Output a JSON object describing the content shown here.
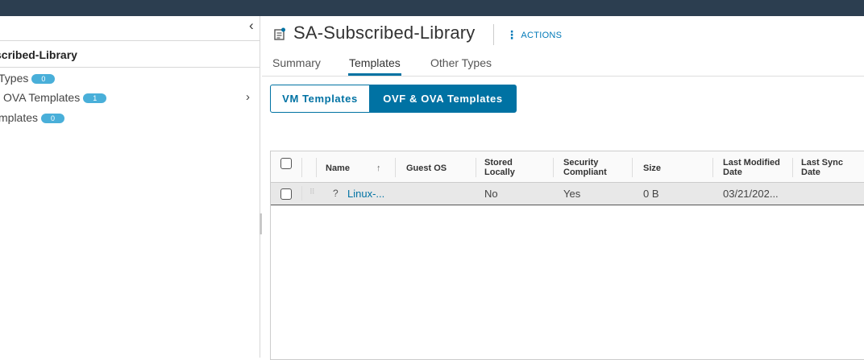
{
  "left_panel": {
    "library_name": "scribed-Library",
    "items": [
      {
        "label": "Types",
        "count": "0"
      },
      {
        "label": "OVA Templates",
        "count": "1"
      },
      {
        "label": "mplates",
        "count": "0"
      }
    ]
  },
  "header": {
    "title": "SA-Subscribed-Library",
    "actions_label": "ACTIONS"
  },
  "tabs": [
    {
      "label": "Summary",
      "active": false
    },
    {
      "label": "Templates",
      "active": true
    },
    {
      "label": "Other Types",
      "active": false
    }
  ],
  "segments": [
    {
      "label": "VM Templates",
      "active": false
    },
    {
      "label": "OVF & OVA Templates",
      "active": true
    }
  ],
  "table": {
    "columns": [
      {
        "line1": "Name",
        "line2": "",
        "sort": "↑"
      },
      {
        "line1": "Guest OS",
        "line2": ""
      },
      {
        "line1": "Stored",
        "line2": "Locally"
      },
      {
        "line1": "Security",
        "line2": "Compliant"
      },
      {
        "line1": "Size",
        "line2": ""
      },
      {
        "line1": "Last Modified",
        "line2": "Date"
      },
      {
        "line1": "Last Sync",
        "line2": "Date"
      }
    ],
    "rows": [
      {
        "status": "?",
        "name": "Linux-...",
        "guest_os": "",
        "stored_locally": "No",
        "security_compliant": "Yes",
        "size": "0 B",
        "last_modified": "03/21/202...",
        "last_sync": ""
      }
    ]
  },
  "colors": {
    "topbar": "#2c3e50",
    "accent": "#0072a3",
    "badge": "#49afd9"
  }
}
